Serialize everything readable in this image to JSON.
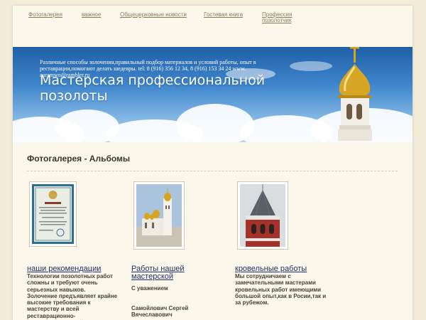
{
  "nav": {
    "items": [
      {
        "label": "Фотогалерея"
      },
      {
        "label": "важное"
      },
      {
        "label": "Общецерковные новости"
      },
      {
        "label": "Гостевая книга"
      },
      {
        "label": "Профессия\nпозолотчик"
      }
    ]
  },
  "banner": {
    "description": "Различные способы золочения,правильный подбор материалов и условий работы, опыт в реставрации,помогают делать шедевры. tel: 8 (916) 356 12 34, 8 (916) 153 34 24 www. auramwo@rambler.ru",
    "title": "Мастерская профессиональной позолоты"
  },
  "section": {
    "title": "Фотогалерея - Альбомы"
  },
  "albums": [
    {
      "title": "наши рекомендации",
      "description": "Технологии позолотных работ  сложны и требуют очень серьезных навыков.\nЗолочение предъявляет крайне высокие требования к мастерству и всей реставрационно-восстановительной деятельности. Когда наносится"
    },
    {
      "title": "Работы нашей мастерской",
      "description": "С уважением\n\n\nСамойлович Сергей Вячеславович"
    },
    {
      "title": "кровельные работы",
      "description": "Мы сотрудничаем с замечательными мастерами кровельных работ имеющими большой опыт,как в Росии,так и за рубежом."
    }
  ],
  "colors": {
    "page_bg": "#f3ecd9",
    "content_bg": "#fbf7ea",
    "link": "#1f2f6e",
    "nav_link": "#8a7a5c",
    "sky": "#3f86cc"
  }
}
